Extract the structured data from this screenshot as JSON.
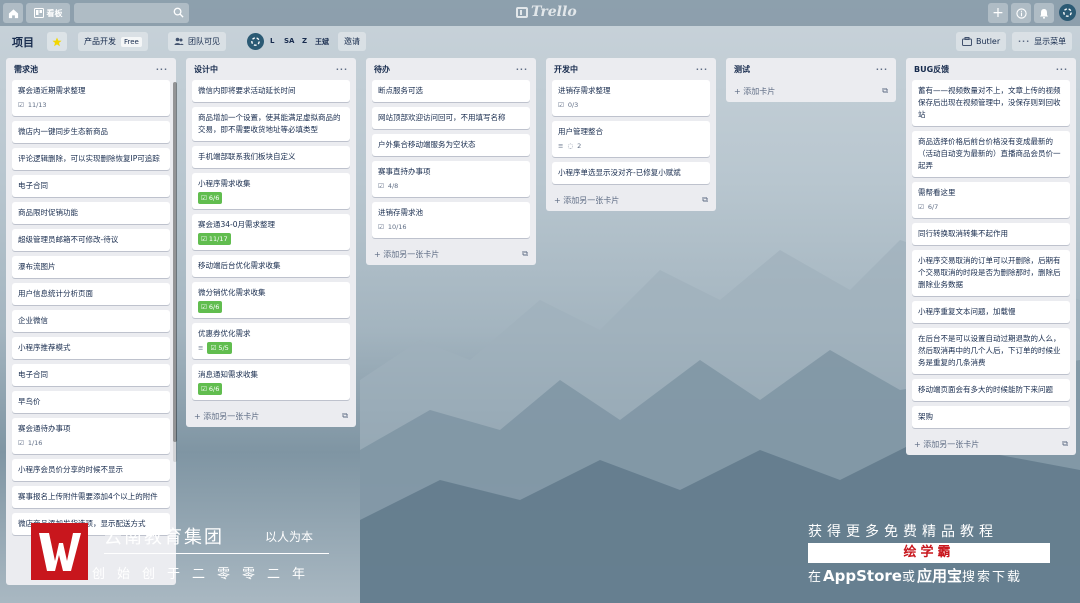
{
  "topbar": {
    "boards_label": "看板",
    "logo_text": "Trello"
  },
  "board": {
    "title": "项目",
    "team_label": "产品开发",
    "team_badge": "Free",
    "visibility_label": "团队可见",
    "members": [
      "L",
      "SA",
      "Z",
      "王斌"
    ],
    "invite_label": "邀请",
    "butler_label": "Butler",
    "menu_label": "显示菜单"
  },
  "lists": [
    {
      "title": "需求池",
      "add_label": "添加另一张卡片",
      "cards": [
        {
          "text": "赛会通近期需求整理",
          "meta": "11/13"
        },
        {
          "text": "微店内一键同步生态新商品"
        },
        {
          "text": "评论逻辑删除，可以实现删除恢复IP可追踪"
        },
        {
          "text": "电子合同"
        },
        {
          "text": "商品限时促销功能"
        },
        {
          "text": "超级管理员邮箱不可修改-待议"
        },
        {
          "text": "瀑布流图片"
        },
        {
          "text": "用户信息统计分析页面"
        },
        {
          "text": "企业微信"
        },
        {
          "text": "小程序推荐模式"
        },
        {
          "text": "电子合同"
        },
        {
          "text": "早鸟价"
        },
        {
          "text": "赛会通待办事项",
          "meta": "1/16"
        },
        {
          "text": "小程序会员价分享的时候不显示"
        },
        {
          "text": "赛事报名上传附件需要添加4个以上的附件"
        },
        {
          "text": "微店商品添加发货选项，显示配送方式"
        }
      ]
    },
    {
      "title": "设计中",
      "add_label": "添加另一张卡片",
      "cards": [
        {
          "text": "微信内即将要求活动延长时间"
        },
        {
          "text": "商品增加一个设置，使其能满足虚拟商品的交易，即不需要收货地址等必填类型"
        },
        {
          "text": "手机端部联系我们板块自定义"
        },
        {
          "text": "小程序需求收集",
          "badge": "6/6"
        },
        {
          "text": "赛会通34-0月需求整理",
          "badge": "11/17"
        },
        {
          "text": "移动端后台优化需求收集"
        },
        {
          "text": "微分销优化需求收集",
          "badge": "6/6"
        },
        {
          "text": "优惠券优化需求",
          "badge": "5/5"
        },
        {
          "text": "消息通知需求收集",
          "badge": "6/6"
        }
      ]
    },
    {
      "title": "待办",
      "add_label": "添加另一张卡片",
      "cards": [
        {
          "text": "断点服务可选"
        },
        {
          "text": "网站顶部欢迎访问回可，不用填写名称"
        },
        {
          "text": "户外集合移动端服务为空状态"
        },
        {
          "text": "赛事直持办事项",
          "meta": "4/8"
        },
        {
          "text": "进销存需求池",
          "meta": "10/16"
        }
      ]
    },
    {
      "title": "开发中",
      "add_label": "添加另一张卡片",
      "cards": [
        {
          "text": "进销存需求整理",
          "meta": "0/3"
        },
        {
          "text": "用户管理整合",
          "meta": "2"
        },
        {
          "text": "小程序单选显示没对齐-已修复小赋斌"
        }
      ]
    },
    {
      "title": "测试",
      "add_label": "添加卡片",
      "cards": []
    },
    {
      "title": "BUG反馈",
      "add_label": "添加另一张卡片",
      "cards": [
        {
          "text": "蓄有——视频数量对不上，文章上传的视频保存后出现在视频管理中，没保存则到回收站"
        },
        {
          "text": "商品选择价格后前台价格没有变成最新的（活动自动变为最新的）直播商品会员价一起弄"
        },
        {
          "text": "需帮看这里",
          "meta": "6/7"
        },
        {
          "text": "同行转换取消转集不起作用"
        },
        {
          "text": "小程序交易取消的订单可以开删除，后期有个交易取消的时段是否为删除那时，删除后删除业务数据"
        },
        {
          "text": "小程序重复文本问题，加载慢"
        },
        {
          "text": "在后台不是可以设置自动过期退款的人么，然后取消再中的几个人后，下订单的时候业务是重复的几条消费"
        },
        {
          "text": "移动端页面会有多大的时候能防下来问题"
        },
        {
          "text": "架购"
        }
      ]
    }
  ],
  "watermark": {
    "left_title": "云南教育集团",
    "left_slogan": "以人为本",
    "left_line2": "创始创于二零零二年",
    "right_line1": "获得更多免费精品教程",
    "right_brand": "绘学霸",
    "right_line3_pre": "在",
    "right_line3_store": "AppStore",
    "right_line3_mid": "或",
    "right_line3_app": "应用宝",
    "right_line3_post": "搜索下载"
  }
}
